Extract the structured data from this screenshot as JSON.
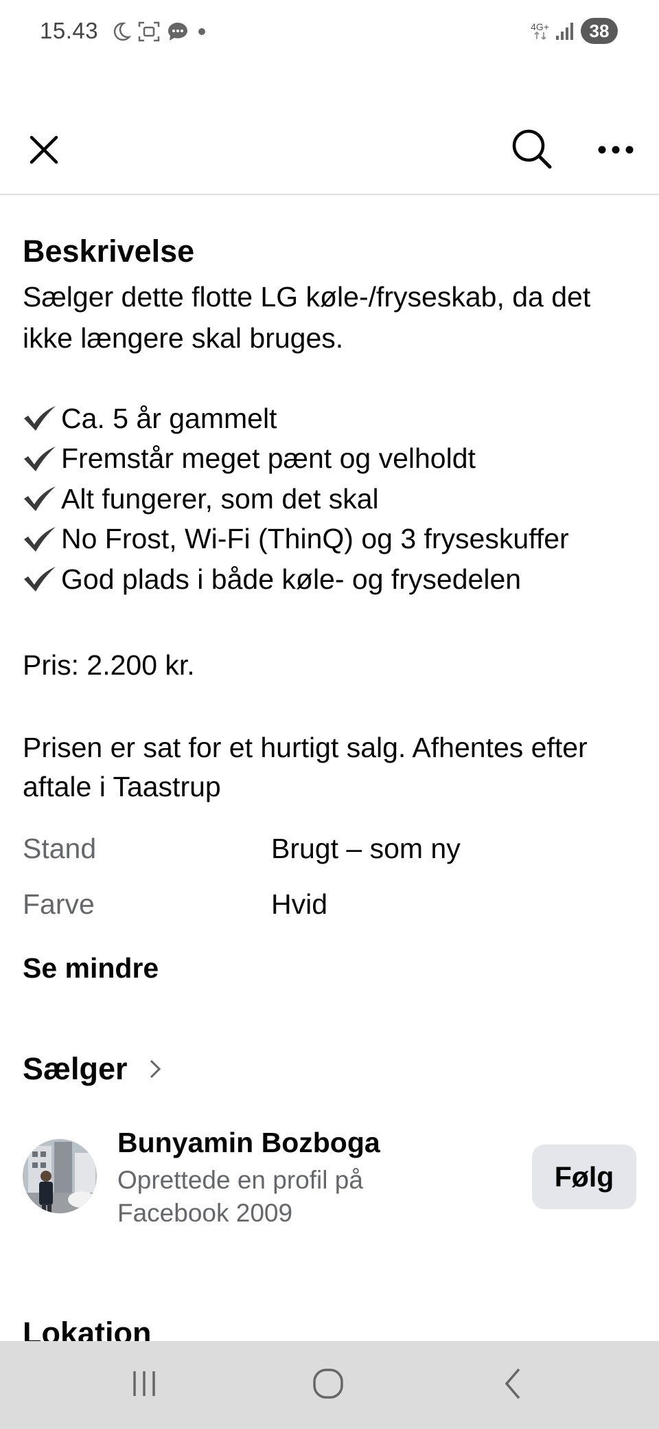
{
  "status_bar": {
    "time": "15.43",
    "network": "4G+",
    "battery": "38"
  },
  "top_nav": {
    "close_icon": "close-icon",
    "search_icon": "search-icon",
    "more_icon": "more-icon"
  },
  "description": {
    "title": "Beskrivelse",
    "intro": "Sælger dette flotte LG køle-/fryseskab, da det ikke længere skal bruges.",
    "checklist": [
      "Ca. 5 år gammelt",
      "Fremstår meget pænt og velholdt",
      "Alt fungerer, som det skal",
      "No Frost, Wi-Fi (ThinQ) og 3 fryseskuffer",
      "God plads i både køle- og frysedelen"
    ],
    "price": "Pris: 2.200 kr.",
    "note": "Prisen er sat for et hurtigt salg. Afhentes efter aftale i Taastrup"
  },
  "details": [
    {
      "label": "Stand",
      "value": "Brugt – som ny"
    },
    {
      "label": "Farve",
      "value": "Hvid"
    }
  ],
  "see_less": "Se mindre",
  "seller": {
    "title": "Sælger",
    "name": "Bunyamin Bozboga",
    "subtitle": "Oprettede en profil på Facebook 2009",
    "follow_label": "Følg"
  },
  "location_title": "Lokation",
  "colors": {
    "text_primary": "#050505",
    "text_secondary": "#65676b",
    "button_bg": "#e4e6eb",
    "nav_bar_bg": "#dcdcdc"
  }
}
